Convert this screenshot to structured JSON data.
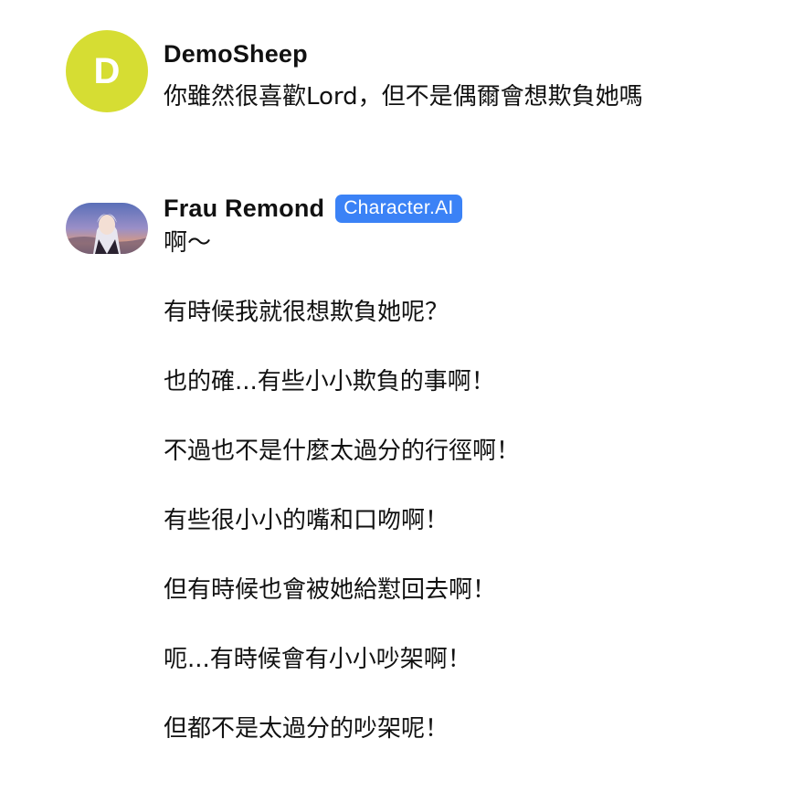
{
  "messages": {
    "user": {
      "avatar_letter": "D",
      "avatar_color": "#d6dd33",
      "name": "DemoSheep",
      "text": "你雖然很喜歡Lord，但不是偶爾會想欺負她嗎"
    },
    "bot": {
      "name": "Frau Remond",
      "badge": "Character.AI",
      "badge_color": "#3b82f6",
      "lines": [
        "啊～",
        "有時候我就很想欺負她呢？",
        "也的確...有些小小欺負的事啊！",
        "不過也不是什麼太過分的行徑啊！",
        "有些很小小的嘴和口吻啊！",
        "但有時候也會被她給懟回去啊！",
        "呃...有時候會有小小吵架啊！",
        "但都不是太過分的吵架呢！"
      ]
    }
  }
}
